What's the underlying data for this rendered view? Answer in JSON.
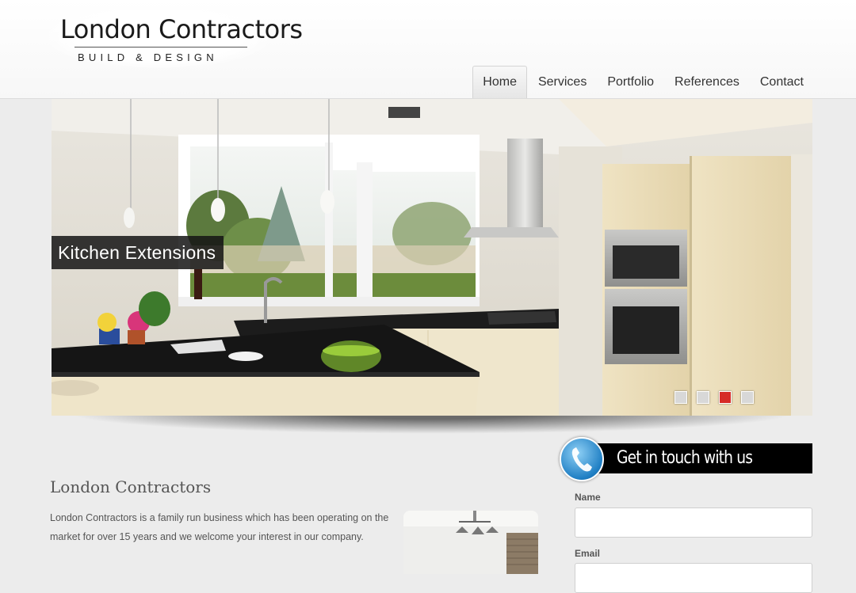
{
  "logo": {
    "title": "London Contractors",
    "subtitle": "BUILD & DESIGN"
  },
  "nav": {
    "items": [
      "Home",
      "Services",
      "Portfolio",
      "References",
      "Contact"
    ],
    "active": "Home"
  },
  "slider": {
    "caption": "Kitchen Extensions",
    "dots_total": 4,
    "active_dot": 3
  },
  "content": {
    "title": "London Contractors",
    "text": "London Contractors is a family run business which has been operating on the market for over 15 years and we welcome your interest in our company."
  },
  "contact": {
    "banner": "Get in touch with us",
    "name_label": "Name",
    "name_value": "",
    "email_label": "Email",
    "email_value": ""
  },
  "colors": {
    "accent": "#d62b26",
    "banner_bg": "#000000",
    "phone_icon": "#1f7fc4"
  }
}
